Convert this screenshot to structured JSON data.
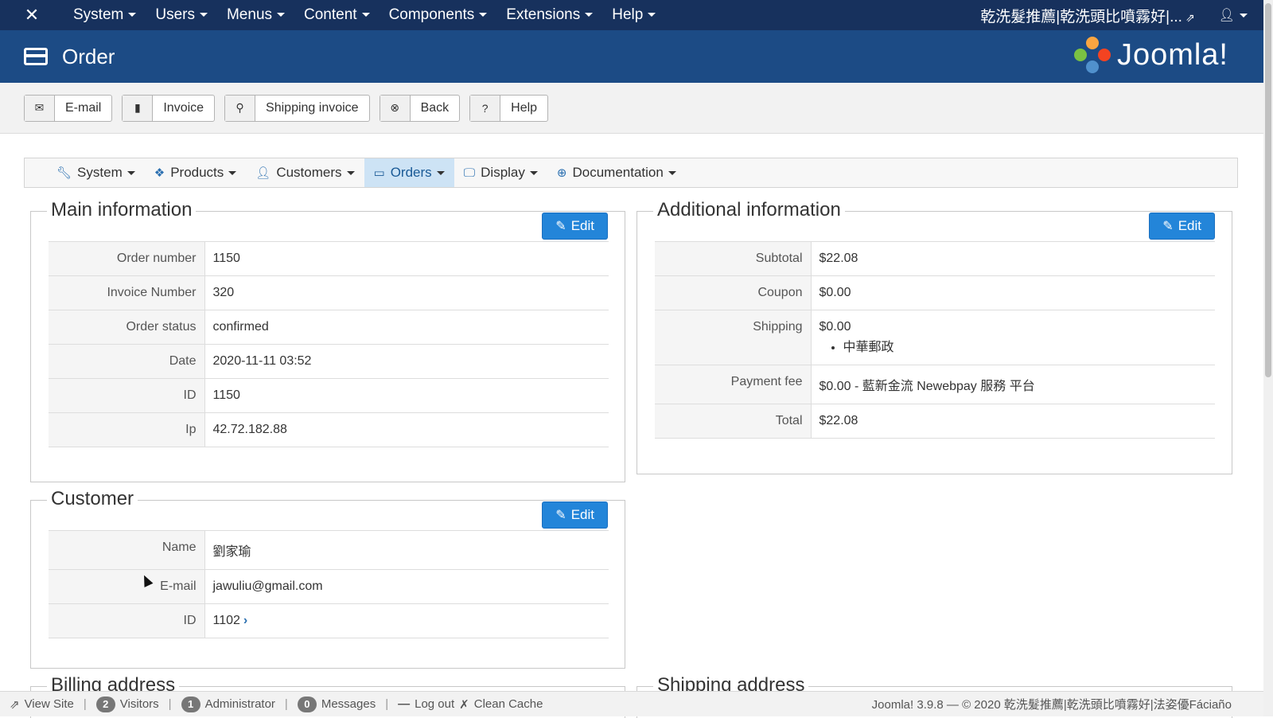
{
  "topnav": {
    "logo_icon": "joomla-x-icon",
    "menus": [
      "System",
      "Users",
      "Menus",
      "Content",
      "Components",
      "Extensions",
      "Help"
    ],
    "site_name": "乾洗髮推薦|乾洗頭比噴霧好|...",
    "user_icon": "user-icon"
  },
  "header": {
    "title": "Order",
    "brand": "Joomla!"
  },
  "toolbar": {
    "buttons": [
      {
        "label": "E-mail",
        "icon": "envelope-icon"
      },
      {
        "label": "Invoice",
        "icon": "book-icon"
      },
      {
        "label": "Shipping invoice",
        "icon": "map-pin-icon"
      },
      {
        "label": "Back",
        "icon": "cancel-icon"
      },
      {
        "label": "Help",
        "icon": "question-icon"
      }
    ]
  },
  "submenu": {
    "items": [
      {
        "label": "System",
        "icon": "wrench-icon",
        "active": false
      },
      {
        "label": "Products",
        "icon": "cubes-icon",
        "active": false
      },
      {
        "label": "Customers",
        "icon": "user-icon",
        "active": false
      },
      {
        "label": "Orders",
        "icon": "credit-card-icon",
        "active": true
      },
      {
        "label": "Display",
        "icon": "monitor-icon",
        "active": false
      },
      {
        "label": "Documentation",
        "icon": "support-icon",
        "active": false
      }
    ]
  },
  "main_info": {
    "legend": "Main information",
    "edit_label": "Edit",
    "rows": [
      {
        "key": "Order number",
        "value": "1150"
      },
      {
        "key": "Invoice Number",
        "value": "320"
      },
      {
        "key": "Order status",
        "value": "confirmed"
      },
      {
        "key": "Date",
        "value": "2020-11-11 03:52"
      },
      {
        "key": "ID",
        "value": "1150"
      },
      {
        "key": "Ip",
        "value": "42.72.182.88"
      }
    ]
  },
  "additional_info": {
    "legend": "Additional information",
    "edit_label": "Edit",
    "subtotal_key": "Subtotal",
    "subtotal": "$22.08",
    "coupon_key": "Coupon",
    "coupon": "$0.00",
    "shipping_key": "Shipping",
    "shipping": "$0.00",
    "shipping_method": "中華郵政",
    "payment_fee_key": "Payment fee",
    "payment_fee": "$0.00 - 藍新金流 Newebpay 服務 平台",
    "total_key": "Total",
    "total": "$22.08"
  },
  "customer": {
    "legend": "Customer",
    "edit_label": "Edit",
    "name_key": "Name",
    "name": "劉家瑜",
    "email_key": "E-mail",
    "email": "jawuliu@gmail.com",
    "id_key": "ID",
    "id": "1102"
  },
  "billing": {
    "legend": "Billing address"
  },
  "shipping_address": {
    "legend": "Shipping address"
  },
  "footer": {
    "view_site": "View Site",
    "visitors_count": "2",
    "visitors_label": "Visitors",
    "admin_count": "1",
    "admin_label": "Administrator",
    "messages_count": "0",
    "messages_label": "Messages",
    "logout": "Log out",
    "clean_cache": "Clean Cache",
    "version": "Joomla! 3.9.8",
    "copyright": "— © 2020 乾洗髮推薦|乾洗頭比噴霧好|法姿優Fáciaño"
  }
}
